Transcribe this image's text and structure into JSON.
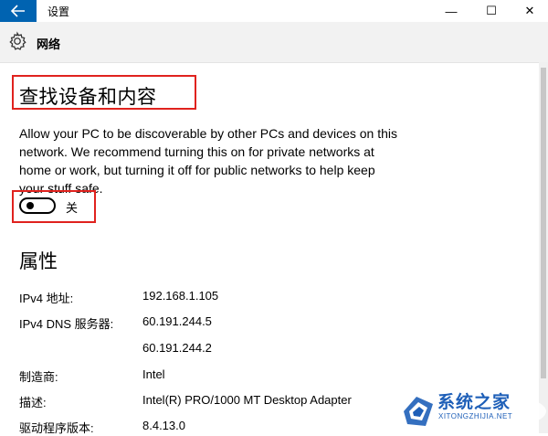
{
  "window": {
    "title": "设置",
    "back_icon": "arrow-left-icon",
    "minimize_symbol": "—",
    "maximize_symbol": "☐",
    "close_symbol": "✕"
  },
  "header": {
    "icon": "gear-icon",
    "title": "网络"
  },
  "discovery": {
    "title": "查找设备和内容",
    "description": "Allow your PC to be discoverable by other PCs and devices on this network. We recommend turning this on for private networks at home or work, but turning it off for public networks to help keep your stuff safe.",
    "toggle_state": "off",
    "toggle_label": "关"
  },
  "properties": {
    "title": "属性",
    "rows": [
      {
        "label": "IPv4 地址:",
        "value": "192.168.1.105"
      },
      {
        "label": "IPv4 DNS 服务器:",
        "value": "60.191.244.5"
      },
      {
        "label": "",
        "value": "60.191.244.2"
      },
      {
        "label": "制造商:",
        "value": "Intel"
      },
      {
        "label": "描述:",
        "value": "Intel(R) PRO/1000 MT Desktop Adapter"
      },
      {
        "label": "驱动程序版本:",
        "value": "8.4.13.0"
      }
    ]
  },
  "watermark": {
    "text": "系统之家",
    "url": "XITONGZHIJIA.NET"
  },
  "colors": {
    "accent": "#0063b1",
    "highlight_border": "#e0221e",
    "watermark": "#1e5fb8"
  }
}
